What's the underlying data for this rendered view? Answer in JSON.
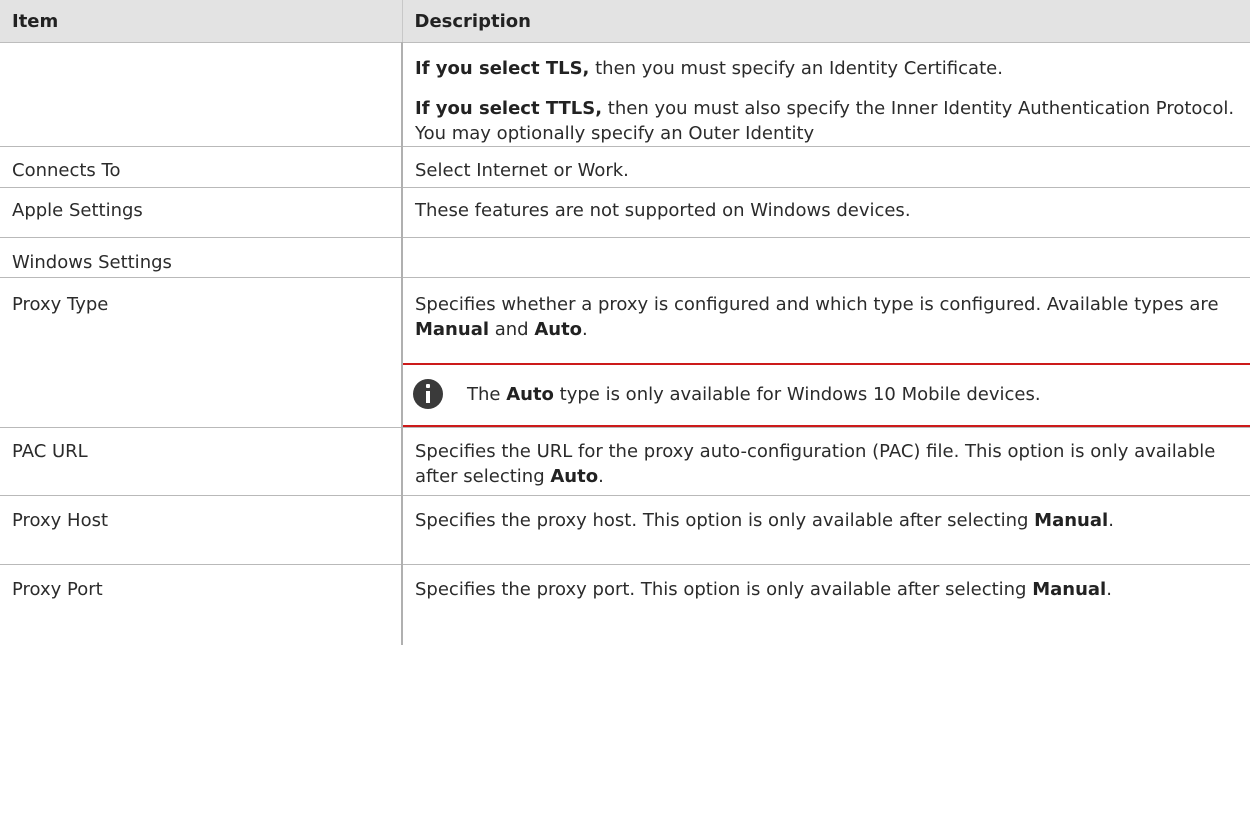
{
  "table": {
    "headers": {
      "item": "Item",
      "description": "Description"
    },
    "rows": {
      "protocol": {
        "item": "",
        "tls_bold": "If you select TLS,",
        "tls_rest": " then you must specify an Identity Certificate.",
        "ttls_bold": "If you select TTLS,",
        "ttls_rest": " then you must also specify the Inner Identity Authentication Protocol. You may optionally specify an Outer Identity"
      },
      "connects_to": {
        "item": "Connects To",
        "desc": "Select Internet or Work."
      },
      "apple_settings": {
        "item": "Apple Settings",
        "desc": "These features are not supported on Windows devices."
      },
      "windows_settings": {
        "item": "Windows Settings",
        "desc": ""
      },
      "proxy_type": {
        "item": "Proxy Type",
        "desc_a": "Specifies whether a proxy is configured and which type is configured. Available types are ",
        "bold_manual": "Manual",
        "desc_and": " and ",
        "bold_auto": "Auto",
        "desc_end": ".",
        "note": {
          "icon": "info-icon",
          "pre": "The ",
          "bold": "Auto",
          "post": " type is only available for Windows 10 Mobile devices."
        }
      },
      "pac_url": {
        "item": "PAC URL",
        "desc": "Specifies the URL for the proxy auto-configuration (PAC) file. This option is only available after selecting ",
        "bold": "Auto",
        "end": "."
      },
      "proxy_host": {
        "item": "Proxy Host",
        "desc": "Specifies the proxy host. This option is only available after selecting ",
        "bold": "Manual",
        "end": "."
      },
      "proxy_port": {
        "item": "Proxy Port",
        "desc": "Specifies the proxy port. This option is only available after selecting ",
        "bold": "Manual",
        "end": "."
      }
    }
  },
  "colors": {
    "header_bg": "#e3e3e3",
    "note_rule": "#cc1a1a",
    "icon_bg": "#3a3a3a"
  }
}
